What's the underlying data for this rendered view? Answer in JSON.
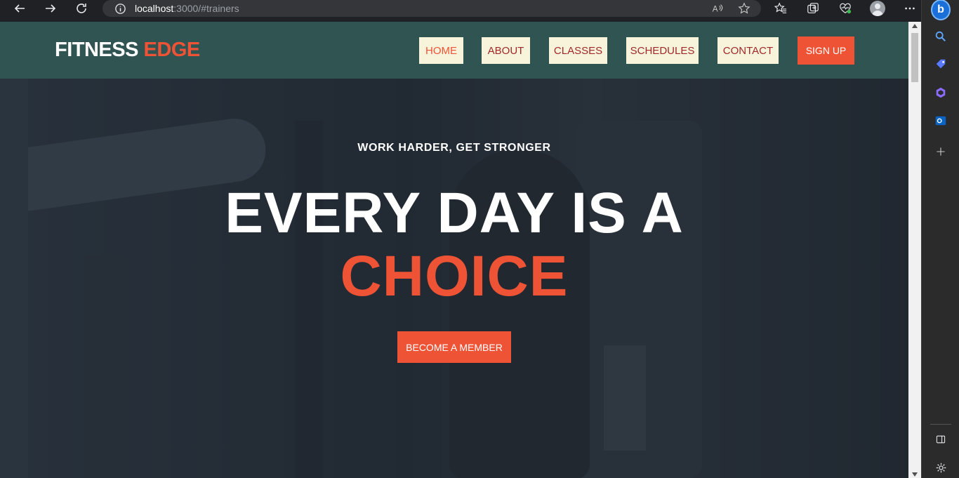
{
  "browser": {
    "url_host": "localhost",
    "url_path": ":3000/#trainers"
  },
  "site": {
    "logo_main": "FITNESS",
    "logo_accent": "EDGE",
    "nav": [
      {
        "label": "HOME",
        "active": true
      },
      {
        "label": "ABOUT",
        "active": false
      },
      {
        "label": "CLASSES",
        "active": false
      },
      {
        "label": "SCHEDULES",
        "active": false
      },
      {
        "label": "CONTACT",
        "active": false
      }
    ],
    "signup_label": "SIGN UP"
  },
  "hero": {
    "tagline": "WORK HARDER, GET STRONGER",
    "headline_line1": "EVERY DAY IS A",
    "headline_line2": "CHOICE",
    "cta_label": "BECOME A MEMBER"
  },
  "colors": {
    "header_bg": "#2f5452",
    "accent": "#ee5336",
    "nav_bg": "#f8f4dc",
    "nav_text": "#a0282a"
  },
  "icons": {
    "back": "back-arrow-icon",
    "forward": "forward-arrow-icon",
    "refresh": "refresh-icon",
    "info": "info-icon",
    "read_aloud": "read-aloud-icon",
    "favorite": "star-icon",
    "favorites": "favorites-icon",
    "collections": "collections-icon",
    "health": "browser-essentials-icon",
    "profile": "profile-avatar",
    "more": "more-icon"
  }
}
